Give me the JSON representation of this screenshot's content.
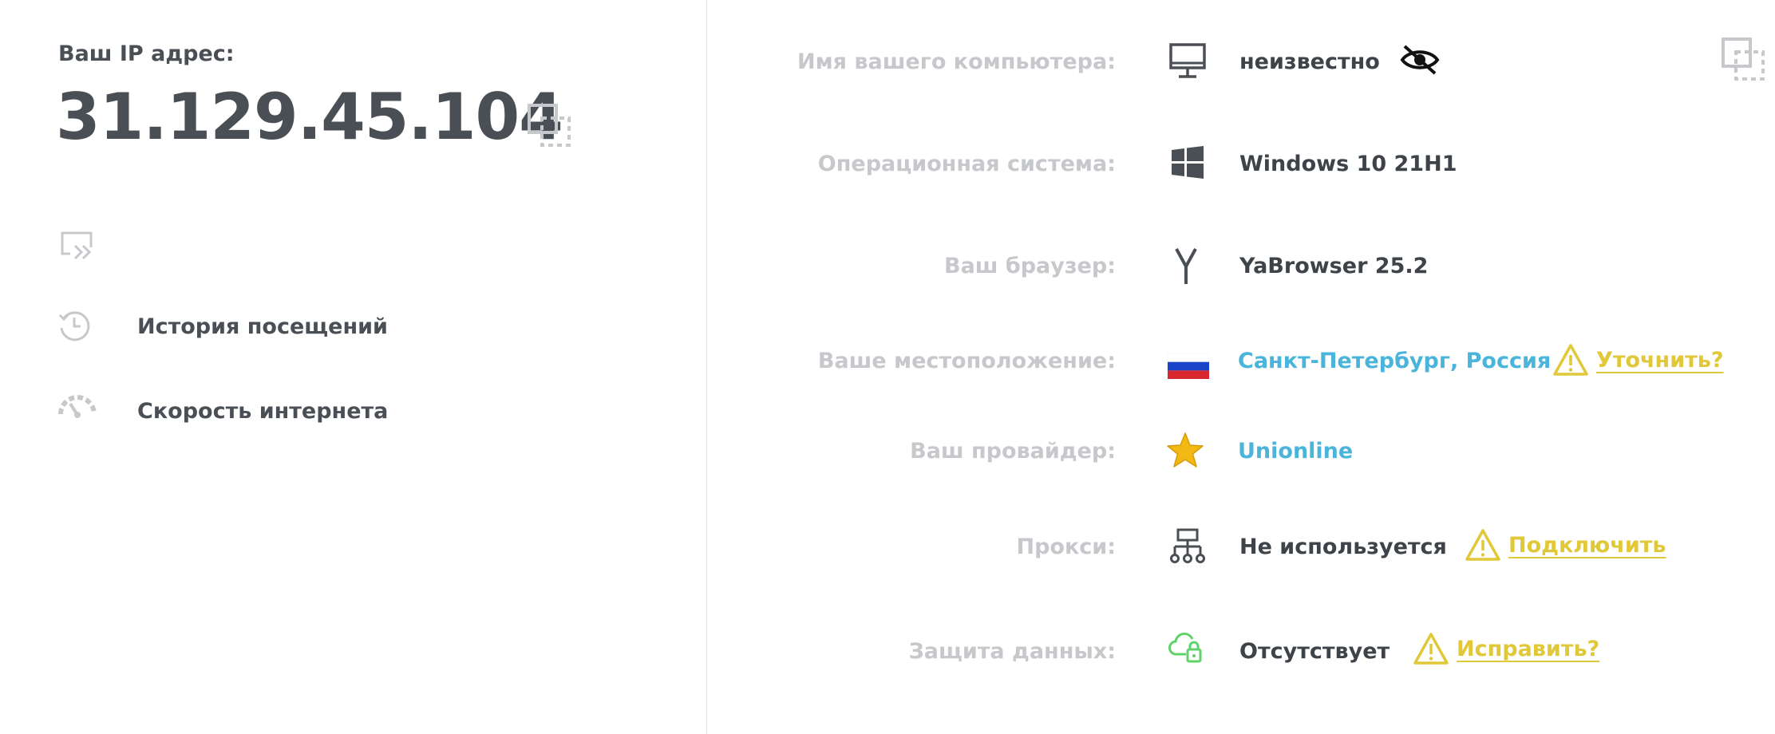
{
  "left": {
    "ip_label": "Ваш IP адрес:",
    "ip_value": "31.129.45.104",
    "copy_icon": "copy-icon",
    "menu": [
      {
        "label": "История посещений",
        "icon": "history-icon"
      },
      {
        "label": "Скорость интернета",
        "icon": "speedometer-icon"
      }
    ]
  },
  "info": {
    "computer": {
      "label": "Имя вашего компьютера:",
      "value": "неизвестно",
      "icon": "monitor-icon"
    },
    "os": {
      "label": "Операционная система:",
      "value": "Windows 10 21H1",
      "icon": "windows-icon"
    },
    "browser": {
      "label": "Ваш браузер:",
      "value": "YaBrowser 25.2",
      "icon": "yandex-browser-icon"
    },
    "location": {
      "label": "Ваше местоположение:",
      "value": "Санкт-Петербург, Россия",
      "icon": "russia-flag-icon",
      "action": "Уточнить?"
    },
    "provider": {
      "label": "Ваш провайдер:",
      "value": "Unionline",
      "icon": "star-icon"
    },
    "proxy": {
      "label": "Прокси:",
      "value": "Не используется",
      "icon": "network-icon",
      "action": "Подключить"
    },
    "protection": {
      "label": "Защита данных:",
      "value": "Отсутствует",
      "icon": "cloud-lock-icon",
      "action": "Исправить?"
    }
  },
  "colors": {
    "text_dark": "#4a4f55",
    "label_gray": "#c6c8cb",
    "link_blue": "#4ab4da",
    "warn_yellow": "#e0c838",
    "green": "#5fd36a"
  }
}
